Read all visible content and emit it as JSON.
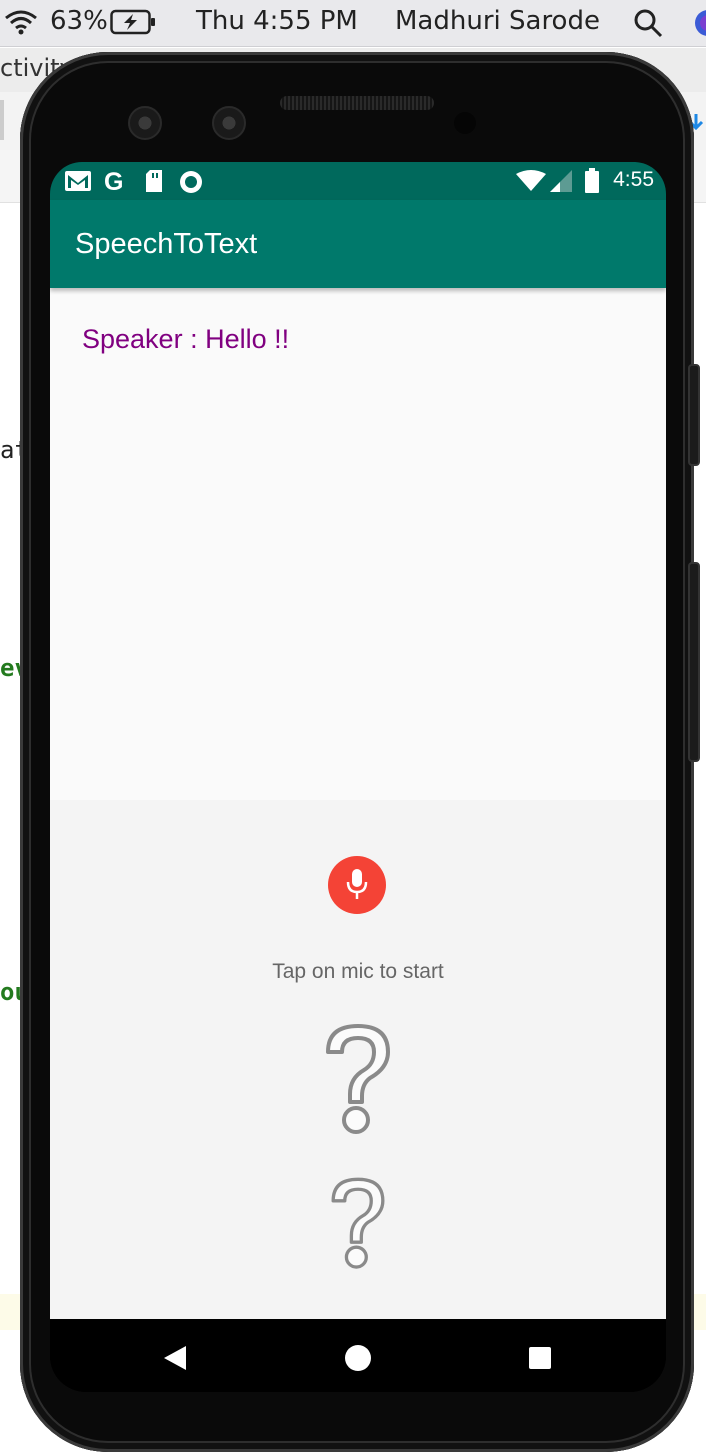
{
  "mac_menubar": {
    "battery": "63%",
    "clock": "Thu 4:55 PM",
    "user": "Madhuri Sarode"
  },
  "background": {
    "tab_fragment": "ctivity",
    "code_fragment_1": "at",
    "code_fragment_2": "ev",
    "code_fragment_3": "ou"
  },
  "colors": {
    "status_bar": "#00695c",
    "app_bar": "#00796b",
    "speaker_text": "#800080",
    "mic_button": "#f44336",
    "code_green": "#237a1e"
  },
  "phone": {
    "status_bar": {
      "time": "4:55",
      "icons_left": [
        "gmail-icon",
        "google-icon",
        "sd-card-icon",
        "sync-icon"
      ],
      "icons_right": [
        "wifi-icon",
        "signal-icon",
        "battery-icon"
      ]
    },
    "app": {
      "title": "SpeechToText",
      "speaker_label": "Speaker : Hello !!",
      "mic_hint": "Tap on mic to start"
    },
    "nav": [
      "back-icon",
      "home-icon",
      "recents-icon"
    ]
  }
}
